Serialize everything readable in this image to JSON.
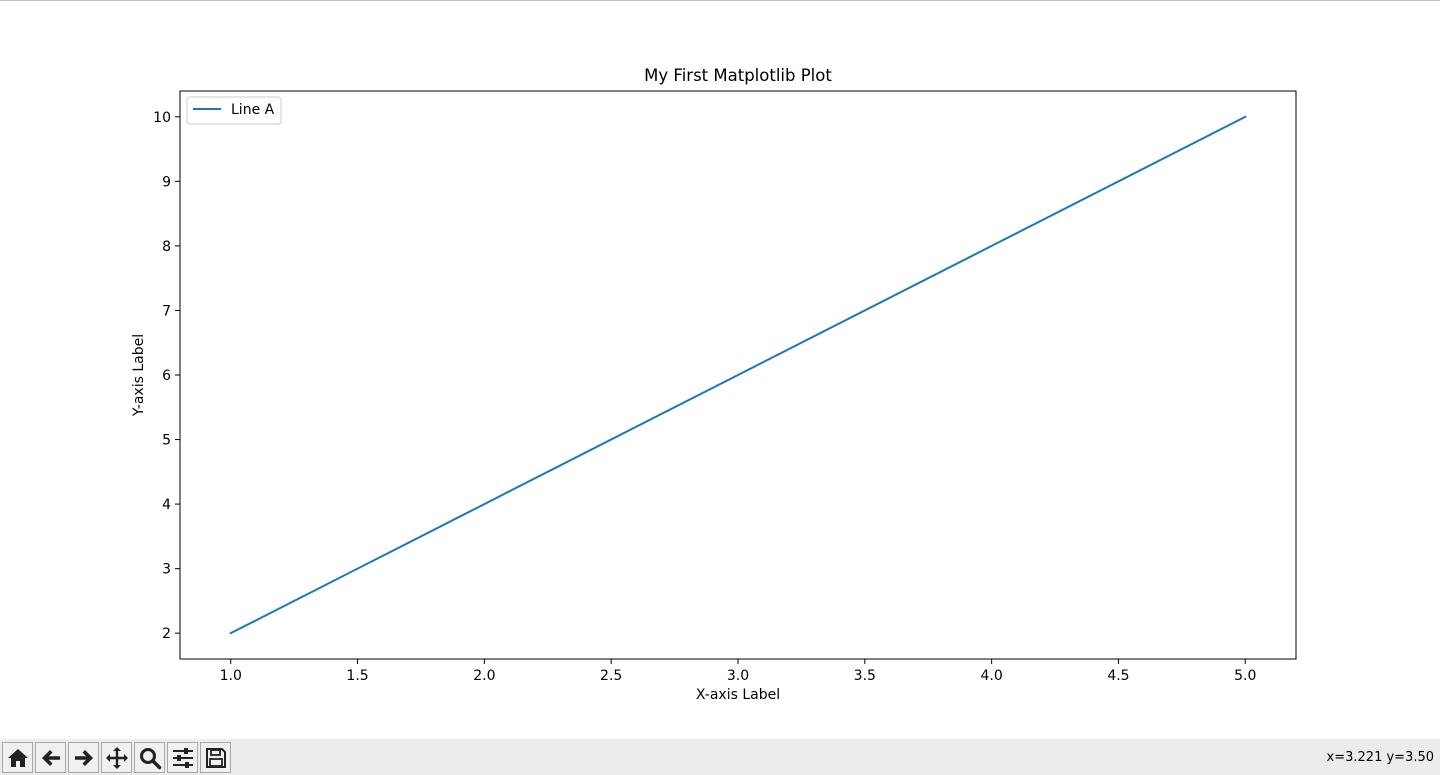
{
  "chart_data": {
    "type": "line",
    "title": "My First Matplotlib Plot",
    "xlabel": "X-axis Label",
    "ylabel": "Y-axis Label",
    "xlim": [
      0.8,
      5.2
    ],
    "ylim": [
      1.6,
      10.4
    ],
    "xticks": [
      1.0,
      1.5,
      2.0,
      2.5,
      3.0,
      3.5,
      4.0,
      4.5,
      5.0
    ],
    "xtick_labels": [
      "1.0",
      "1.5",
      "2.0",
      "2.5",
      "3.0",
      "3.5",
      "4.0",
      "4.5",
      "5.0"
    ],
    "yticks": [
      2,
      3,
      4,
      5,
      6,
      7,
      8,
      9,
      10
    ],
    "ytick_labels": [
      "2",
      "3",
      "4",
      "5",
      "6",
      "7",
      "8",
      "9",
      "10"
    ],
    "grid": false,
    "legend_position": "upper-left",
    "series": [
      {
        "name": "Line A",
        "color": "#1f77b4",
        "x": [
          1,
          2,
          3,
          4,
          5
        ],
        "y": [
          2,
          4,
          6,
          8,
          10
        ]
      }
    ]
  },
  "toolbar": {
    "buttons": [
      {
        "name": "home-button",
        "icon": "home-icon",
        "title": "Home"
      },
      {
        "name": "back-button",
        "icon": "arrow-left-icon",
        "title": "Back"
      },
      {
        "name": "forward-button",
        "icon": "arrow-right-icon",
        "title": "Forward"
      },
      {
        "name": "pan-button",
        "icon": "move-icon",
        "title": "Pan"
      },
      {
        "name": "zoom-button",
        "icon": "magnifier-icon",
        "title": "Zoom"
      },
      {
        "name": "configure-subplots-button",
        "icon": "sliders-icon",
        "title": "Subplots"
      },
      {
        "name": "save-button",
        "icon": "floppy-disk-icon",
        "title": "Save"
      }
    ],
    "coordinates": "x=3.221 y=3.50"
  }
}
